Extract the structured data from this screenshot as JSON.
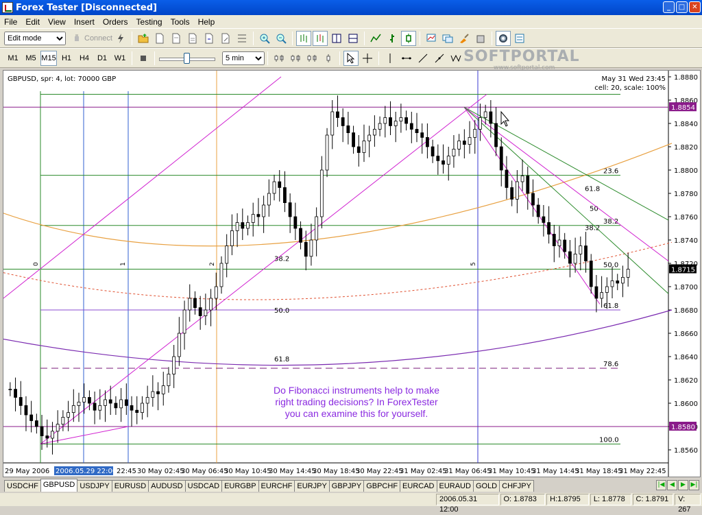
{
  "window": {
    "title": "Forex Tester [Disconnected]"
  },
  "menu": [
    "File",
    "Edit",
    "View",
    "Insert",
    "Orders",
    "Testing",
    "Tools",
    "Help"
  ],
  "toolbar": {
    "mode_value": "Edit mode",
    "connect_label": "Connect",
    "timeframes": [
      "M1",
      "M5",
      "M15",
      "H1",
      "H4",
      "D1",
      "W1"
    ],
    "active_timeframe": "M15",
    "speed_value": "5 min"
  },
  "watermark": {
    "text": "SOFTPORTAL",
    "sub": "www.softportal.com"
  },
  "chart": {
    "info_left": "GBPUSD, spr: 4, lot: 70000 GBP",
    "info_right_1": "May 31 Wed 23:45",
    "info_right_2": "cell: 20, scale: 100%",
    "note": [
      "Do Fibonacci instruments help to make",
      "right trading decisions? In ForexTester",
      "you can examine this for yourself."
    ],
    "price_labels": [
      "1.8880",
      "1.8860",
      "1.8840",
      "1.8820",
      "1.8800",
      "1.8780",
      "1.8760",
      "1.8740",
      "1.8720",
      "1.8700",
      "1.8680",
      "1.8660",
      "1.8640",
      "1.8620",
      "1.8600",
      "1.8580",
      "1.8560"
    ],
    "marker_top": "1.8854",
    "marker_current": "1.8715",
    "marker_low": "1.8580",
    "time_labels": [
      "29 May 2006",
      "2006.05.29 22:00",
      "22:45",
      "30 May 02:45",
      "30 May 06:45",
      "30 May 10:45",
      "30 May 14:45",
      "30 May 18:45",
      "30 May 22:45",
      "31 May 02:45",
      "31 May 06:45",
      "31 May 10:45",
      "31 May 14:45",
      "31 May 18:45",
      "31 May 22:45"
    ],
    "time_zone_numbers": [
      "0",
      "1",
      "2",
      "5"
    ],
    "fib_labels": {
      "l382_mid": "38.2",
      "l50_mid": "50.0",
      "l618_mid": "61.8",
      "r236": "23.6",
      "r382": "38.2",
      "r50": "50.0",
      "r618": "61.8",
      "r786": "78.6",
      "r100": "100.0",
      "fan618": "61.8",
      "fan50": "50",
      "fan382": "38.2"
    }
  },
  "chart_data": {
    "type": "candlestick",
    "symbol": "GBPUSD",
    "ylim": [
      1.855,
      1.889
    ],
    "close_series": [
      1.8612,
      1.8605,
      1.8598,
      1.859,
      1.8585,
      1.858,
      1.8572,
      1.857,
      1.8576,
      1.8582,
      1.8588,
      1.8592,
      1.8598,
      1.8601,
      1.8605,
      1.86,
      1.8594,
      1.8598,
      1.8603,
      1.86,
      1.8596,
      1.8603,
      1.8598,
      1.8594,
      1.8592,
      1.86,
      1.8605,
      1.861,
      1.8608,
      1.8615,
      1.8625,
      1.864,
      1.866,
      1.868,
      1.869,
      1.8682,
      1.8675,
      1.868,
      1.869,
      1.87,
      1.872,
      1.8735,
      1.8748,
      1.8755,
      1.875,
      1.8755,
      1.8762,
      1.876,
      1.877,
      1.878,
      1.879,
      1.8785,
      1.8772,
      1.876,
      1.875,
      1.8738,
      1.8726,
      1.874,
      1.876,
      1.88,
      1.883,
      1.885,
      1.8845,
      1.8838,
      1.8832,
      1.882,
      1.8815,
      1.8825,
      1.883,
      1.8835,
      1.884,
      1.8845,
      1.8838,
      1.8842,
      1.8845,
      1.884,
      1.8835,
      1.8832,
      1.8828,
      1.882,
      1.8812,
      1.8808,
      1.8805,
      1.8812,
      1.8818,
      1.8825,
      1.8822,
      1.8828,
      1.8835,
      1.8845,
      1.885,
      1.884,
      1.882,
      1.88,
      1.8785,
      1.8775,
      1.879,
      1.8795,
      1.878,
      1.877,
      1.876,
      1.8755,
      1.8745,
      1.8735,
      1.874,
      1.873,
      1.872,
      1.8728,
      1.8735,
      1.8722,
      1.87,
      1.869,
      1.8695,
      1.87,
      1.8705,
      1.8703,
      1.8708,
      1.8715
    ]
  },
  "tabs": [
    "USDCHF",
    "GBPUSD",
    "USDJPY",
    "EURUSD",
    "AUDUSD",
    "USDCAD",
    "EURGBP",
    "EURCHF",
    "EURJPY",
    "GBPJPY",
    "GBPCHF",
    "EURCAD",
    "EURAUD",
    "GOLD",
    "CHFJPY"
  ],
  "active_tab": "GBPUSD",
  "status": {
    "datetime": "2006.05.31 12:00",
    "open": "O: 1.8783",
    "high": "H:1.8795",
    "low": "L: 1.8778",
    "close": "C: 1.8791",
    "volume": "V: 267"
  }
}
